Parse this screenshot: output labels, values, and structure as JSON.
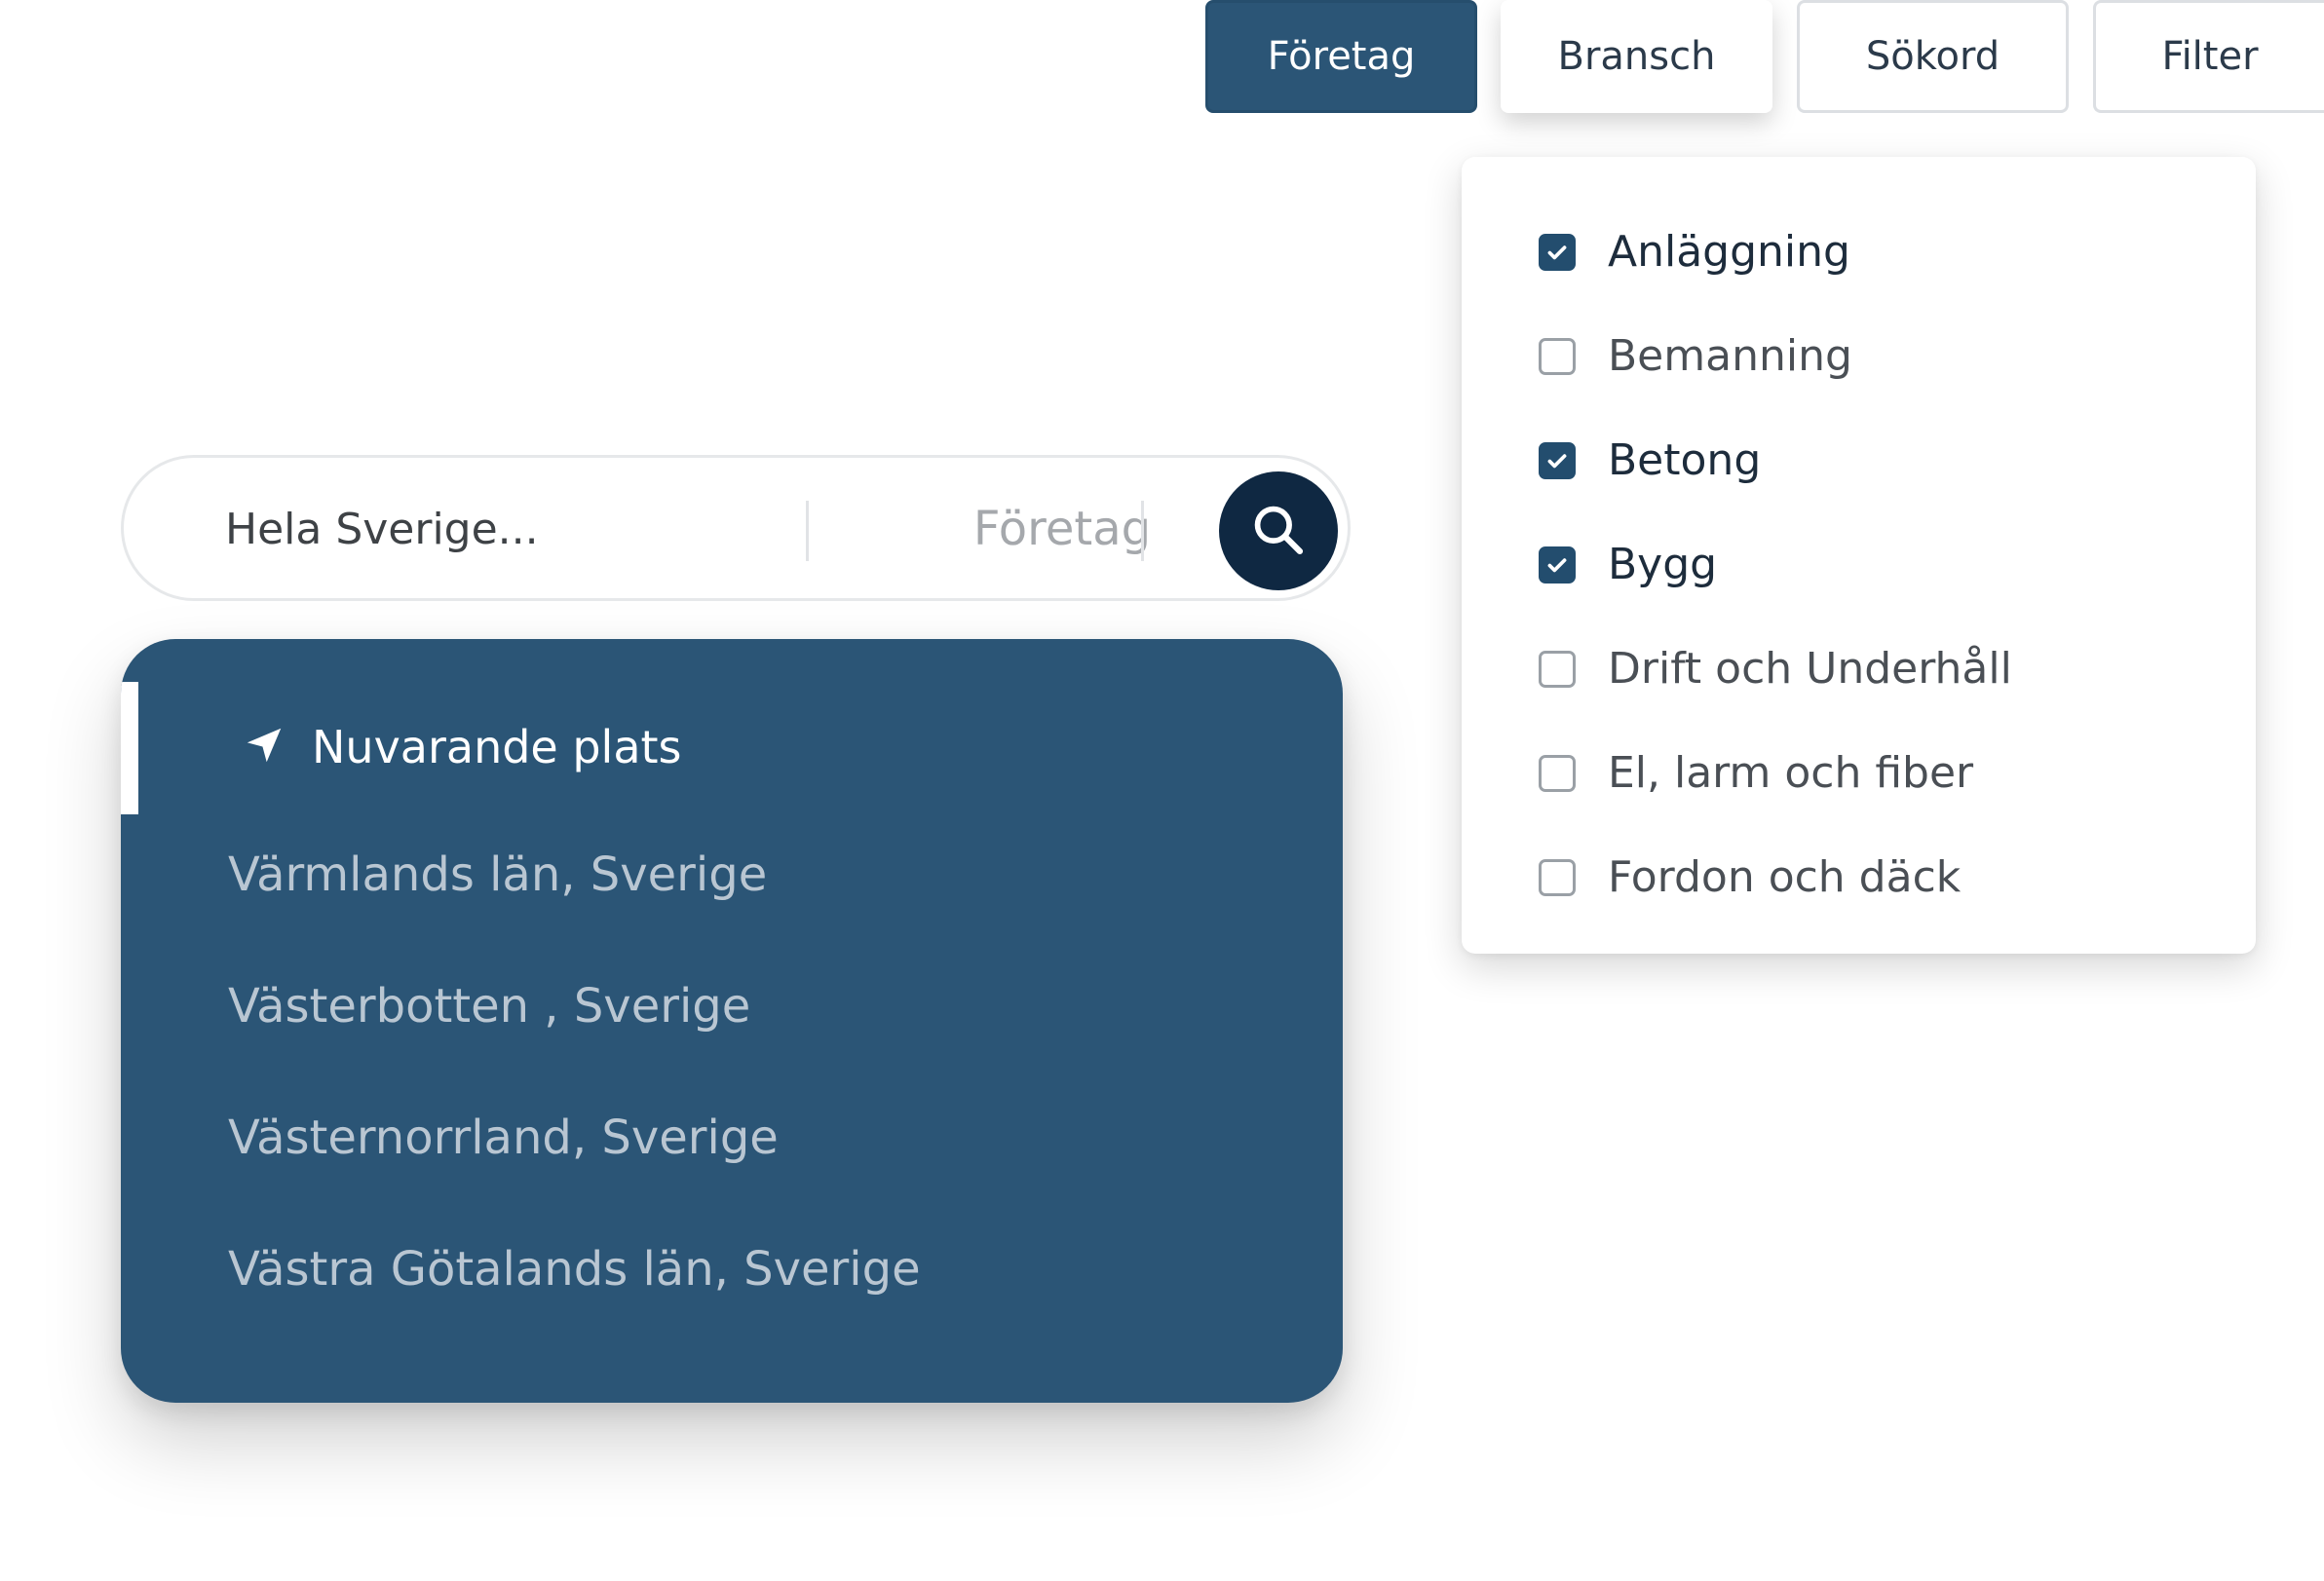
{
  "tabs": [
    {
      "label": "Företag",
      "active": true
    },
    {
      "label": "Bransch",
      "active": false
    },
    {
      "label": "Sökord",
      "active": false
    },
    {
      "label": "Filter",
      "active": false
    }
  ],
  "industry_dropdown": {
    "items": [
      {
        "label": "Anläggning",
        "checked": true
      },
      {
        "label": "Bemanning",
        "checked": false
      },
      {
        "label": "Betong",
        "checked": true
      },
      {
        "label": "Bygg",
        "checked": true
      },
      {
        "label": "Drift och Underhåll",
        "checked": false
      },
      {
        "label": "El, larm och fiber",
        "checked": false
      },
      {
        "label": "Fordon och däck",
        "checked": false
      }
    ]
  },
  "search": {
    "location_placeholder": "Hela Sverige...",
    "company_placeholder": "Företag",
    "button_icon": "search-icon"
  },
  "location_dropdown": {
    "current_location_label": "Nuvarande plats",
    "current_location_icon": "navigation-arrow-icon",
    "items": [
      "Värmlands län, Sverige",
      "Västerbotten , Sverige",
      "Västernorrland, Sverige",
      "Västra Götalands län, Sverige"
    ]
  },
  "colors": {
    "brand_blue": "#2b5576",
    "dark_navy": "#0f2842",
    "checkbox_checked": "#234d6e"
  }
}
